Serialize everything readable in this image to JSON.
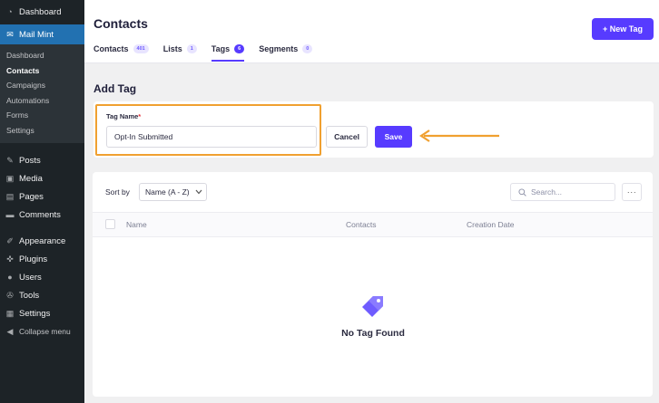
{
  "sidebar": {
    "top_items": [
      {
        "label": "Dashboard",
        "icon": "dashboard-icon"
      },
      {
        "label": "Mail Mint",
        "icon": "mail-icon",
        "active": true
      }
    ],
    "submenu": [
      {
        "label": "Dashboard"
      },
      {
        "label": "Contacts",
        "current": true
      },
      {
        "label": "Campaigns"
      },
      {
        "label": "Automations"
      },
      {
        "label": "Forms"
      },
      {
        "label": "Settings"
      }
    ],
    "group1": [
      {
        "label": "Posts",
        "icon": "pin-icon"
      },
      {
        "label": "Media",
        "icon": "media-icon"
      },
      {
        "label": "Pages",
        "icon": "pages-icon"
      },
      {
        "label": "Comments",
        "icon": "comment-icon"
      }
    ],
    "group2": [
      {
        "label": "Appearance",
        "icon": "brush-icon"
      },
      {
        "label": "Plugins",
        "icon": "plugin-icon"
      },
      {
        "label": "Users",
        "icon": "user-icon"
      },
      {
        "label": "Tools",
        "icon": "wrench-icon"
      },
      {
        "label": "Settings",
        "icon": "settings-icon"
      }
    ],
    "collapse": "Collapse menu"
  },
  "header": {
    "title": "Contacts",
    "new_button": "+ New Tag",
    "tabs": [
      {
        "label": "Contacts",
        "count": "401"
      },
      {
        "label": "Lists",
        "count": "1"
      },
      {
        "label": "Tags",
        "count": "6",
        "active": true
      },
      {
        "label": "Segments",
        "count": "0"
      }
    ]
  },
  "form": {
    "title": "Add Tag",
    "label": "Tag Name",
    "required_mark": "*",
    "value": "Opt-In Submitted",
    "cancel": "Cancel",
    "save": "Save"
  },
  "list": {
    "sort_label": "Sort by",
    "sort_value": "Name (A - Z)",
    "search_placeholder": "Search...",
    "more": "···",
    "columns": [
      "Name",
      "Contacts",
      "Creation Date"
    ],
    "empty_text": "No Tag Found"
  },
  "colors": {
    "accent": "#573bff",
    "highlight": "#f0a030",
    "sidebar_bg": "#1d2327",
    "sidebar_active": "#2271b1"
  }
}
